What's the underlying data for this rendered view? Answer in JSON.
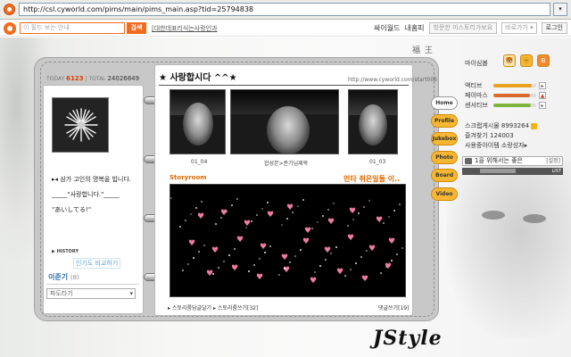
{
  "browser": {
    "url": "http://csl.cyworld.com/pims/main/pims_main.asp?tid=25794838",
    "go_arrow": "▾"
  },
  "toolbar": {
    "search_placeholder": "이 필드 보는 안내",
    "search_button": "검색",
    "tagline": "[대한데표리식는사랑인과",
    "menu": {
      "cyworld": "싸이월드",
      "my_hompy": "내홈피",
      "visit_btn": "방문한 미스토리가보요",
      "go_select": "바로가기 ▾",
      "login": "로그인"
    }
  },
  "top_deco": "福 王",
  "stats": {
    "today_label": "TODAY",
    "today_value": "6123",
    "total_label": "TOTAL",
    "total_value": "24026849"
  },
  "left": {
    "lines": [
      "▸◂ 삼가 고인의 명복을 빕니다.",
      "_____\"사랑합니다.\"_____",
      "\"あいしてる!\""
    ],
    "history": "▶ HISTORY",
    "compare_link": "인기도 비교하기",
    "owner_name": "이준기",
    "owner_count": "(8)",
    "wave_select": "파도타기"
  },
  "main": {
    "title": "★ 사랑합시다 ^^★",
    "url": "http://www.cyworld.com/start006",
    "photos": [
      {
        "caption": "01_04"
      },
      {
        "caption": "합성본>준기님제목"
      },
      {
        "caption": "01_03"
      }
    ],
    "storyroom_label": "Storyroom",
    "story_message": "먼타 쥐은일들 이..",
    "story_footer_left": "▸ 스토리룸담글달기 ▸ 스토리룸쓰기[32]",
    "story_footer_right": "댓글쓰기[19]"
  },
  "tabs": [
    "Home",
    "Profile",
    "Jukebox",
    "Photo",
    "Board",
    "Video"
  ],
  "side": {
    "my_label": "마이심볼",
    "icons": [
      "🐯",
      "ⓦ",
      "B"
    ],
    "bars": [
      {
        "label": "액티브",
        "value": 0.9,
        "color": "#e8a21f"
      },
      {
        "label": "페이마스",
        "value": 0.85,
        "color": "#d96a2c"
      },
      {
        "label": "센서티브",
        "value": 0.88,
        "color": "#7fb43a"
      }
    ],
    "bar_arrows": [
      "▸",
      "▲",
      "▸"
    ],
    "info": [
      "스크랩게시물 8993264",
      "즐겨찾기 124003",
      "사용중아이템 소랑성자▸"
    ],
    "bgm_title": "1을 위해서는 좋은",
    "bgm_setting": "[설정]",
    "bgm_list": "LIST"
  },
  "signature": "JStyle"
}
